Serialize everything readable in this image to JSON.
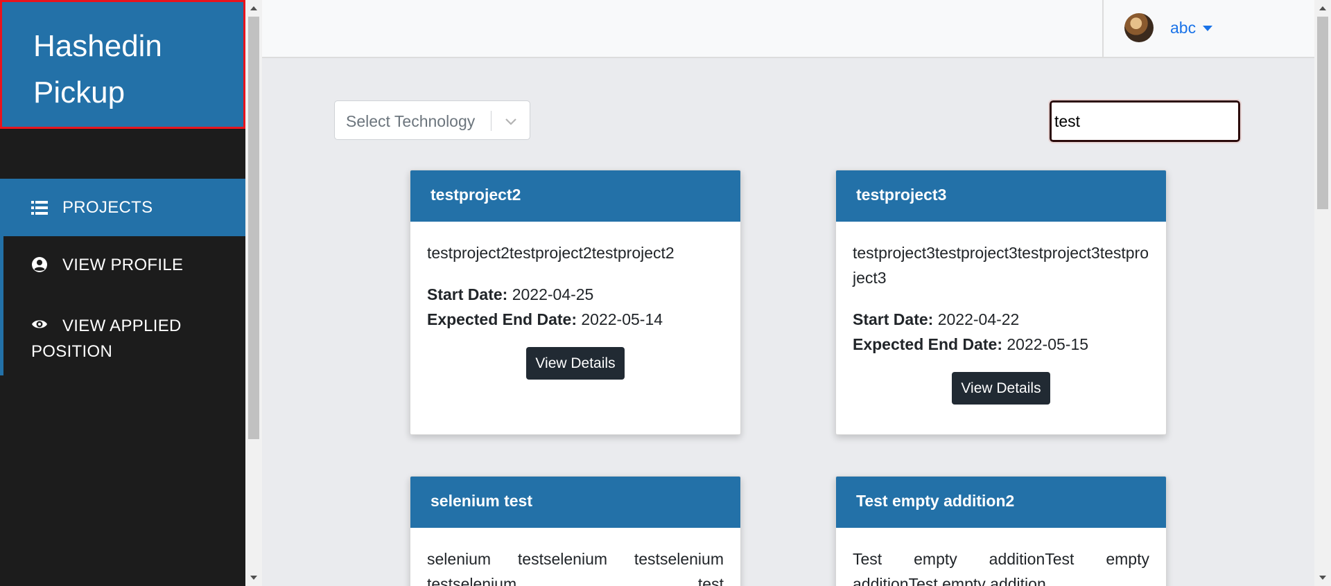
{
  "brand": {
    "title": "Hashedin Pickup"
  },
  "sidebar": {
    "items": [
      {
        "label": "PROJECTS",
        "icon": "list-icon",
        "active": true
      },
      {
        "label": "VIEW PROFILE",
        "icon": "user-circle-icon",
        "active": false
      },
      {
        "label": "VIEW APPLIED POSITION",
        "icon": "eye-icon",
        "active": false
      }
    ]
  },
  "topbar": {
    "user": "abc",
    "avatar_icon": "avatar-image"
  },
  "filters": {
    "technology_placeholder": "Select Technology",
    "search_value": "test"
  },
  "colors": {
    "primary": "#2371a8",
    "sidebar": "#1c1c1c",
    "button": "#212a33",
    "brand_border": "#e8141d"
  },
  "projects": [
    {
      "name": "testproject2",
      "description": "testproject2testproject2testproject2",
      "start_label": "Start Date:",
      "start": "2022-04-25",
      "end_label": "Expected End Date:",
      "end": "2022-05-14",
      "button": "View Details"
    },
    {
      "name": "testproject3",
      "description": "testproject3testproject3testproject3testproject3",
      "start_label": "Start Date:",
      "start": "2022-04-22",
      "end_label": "Expected End Date:",
      "end": "2022-05-15",
      "button": "View Details"
    },
    {
      "name": "selenium test",
      "description": "selenium testselenium testselenium testselenium test"
    },
    {
      "name": "Test empty addition2",
      "description": "Test empty additionTest empty additionTest empty addition"
    }
  ]
}
